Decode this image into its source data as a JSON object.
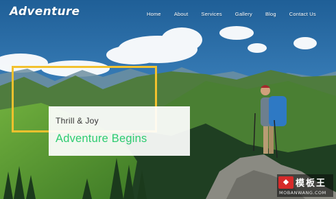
{
  "header": {
    "logo": "Adventure",
    "nav": [
      "Home",
      "About",
      "Services",
      "Gallery",
      "Blog",
      "Contact Us"
    ]
  },
  "hero": {
    "tagline": "Thrill & Joy",
    "headline": "Adventure Begins"
  },
  "watermark": {
    "title": "模板王",
    "url": "MOBANWANG.COM"
  },
  "colors": {
    "accent_frame": "#f2c12e",
    "headline_green": "#2ecc71",
    "sky": "#2f6a9e"
  }
}
